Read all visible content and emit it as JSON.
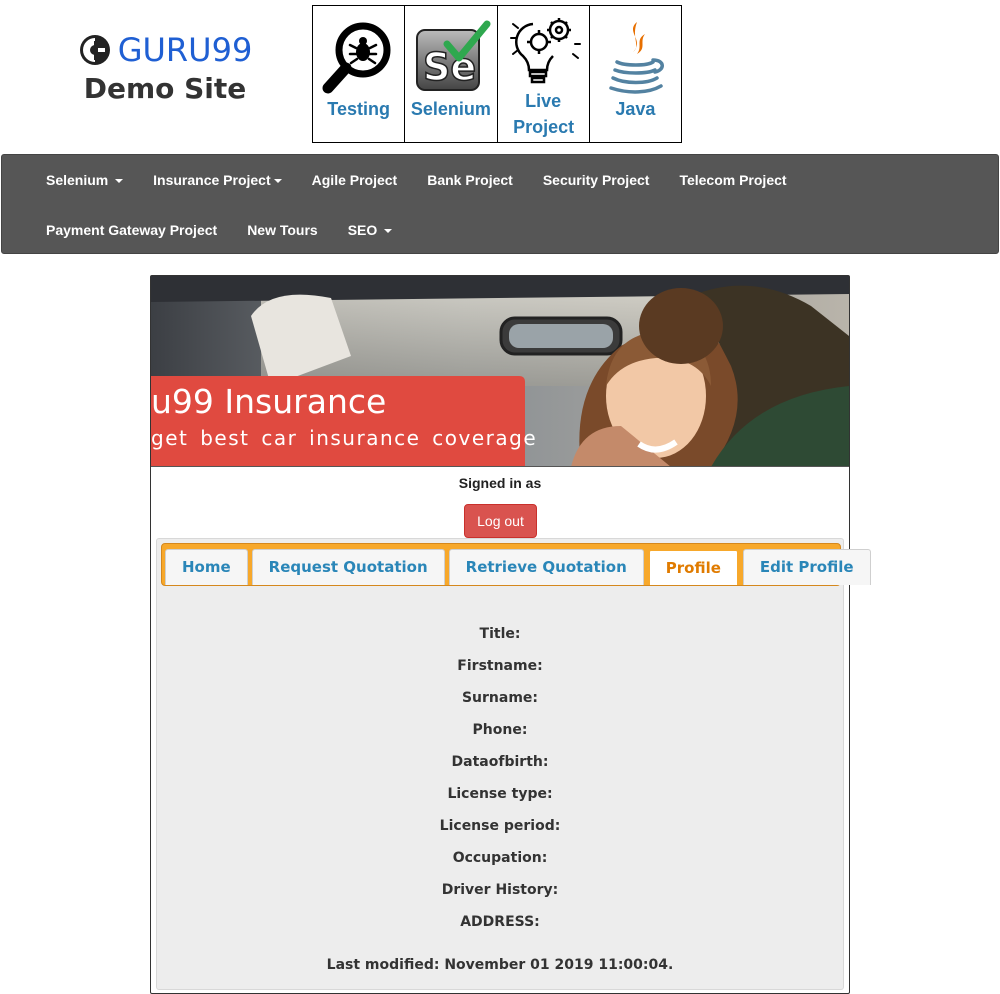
{
  "header": {
    "brand": "GURU99",
    "subtitle": "Demo Site",
    "quicklinks": [
      {
        "label": "Testing",
        "icon": "magnifier-bug-icon"
      },
      {
        "label": "Selenium",
        "icon": "selenium-logo-icon"
      },
      {
        "label": "Live Project",
        "icon": "lightbulb-gears-icon"
      },
      {
        "label": "Java",
        "icon": "java-logo-icon"
      }
    ]
  },
  "nav": {
    "row1": [
      "Selenium",
      "Insurance Project",
      "Agile Project",
      "Bank Project",
      "Security Project",
      "Telecom Project"
    ],
    "row2": [
      "Payment Gateway Project",
      "New Tours",
      "SEO"
    ]
  },
  "banner": {
    "title": "u99 Insurance",
    "subtitle": "get best car insurance coverage"
  },
  "account": {
    "signed_in": "Signed in as",
    "logout": "Log out"
  },
  "tabs": [
    "Home",
    "Request Quotation",
    "Retrieve Quotation",
    "Profile",
    "Edit Profile"
  ],
  "active_tab": "Profile",
  "profile_fields": [
    "Title:",
    "Firstname:",
    "Surname:",
    "Phone:",
    "Dataofbirth:",
    "License type:",
    "License period:",
    "Occupation:",
    "Driver History:",
    "ADDRESS:"
  ],
  "last_modified": "Last modified: November 01 2019 11:00:04.",
  "colors": {
    "brand": "#1f5fd3",
    "link": "#2a7ab0",
    "navbar": "#565656",
    "danger": "#d9534f",
    "tabbar": "#f7a82b",
    "active_tab": "#e07b00"
  }
}
